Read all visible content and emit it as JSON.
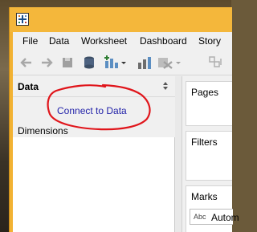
{
  "menubar": {
    "items": [
      "File",
      "Data",
      "Worksheet",
      "Dashboard",
      "Story"
    ]
  },
  "toolbar": {
    "icons": [
      "back-arrow-icon",
      "forward-arrow-icon",
      "save-icon",
      "datasource-icon",
      "new-worksheet-icon",
      "chart-icon",
      "clear-icon",
      "swap-icon"
    ]
  },
  "data_pane": {
    "title": "Data",
    "connect_link": "Connect to Data",
    "dimensions_label": "Dimensions"
  },
  "shelves": {
    "pages_label": "Pages",
    "filters_label": "Filters",
    "marks_label": "Marks",
    "marks_type_icon": "Abc",
    "marks_type_value": "Autom"
  },
  "colors": {
    "titlebar": "#f4b73b",
    "link": "#1f1fa8",
    "annotation": "#e0151b"
  }
}
